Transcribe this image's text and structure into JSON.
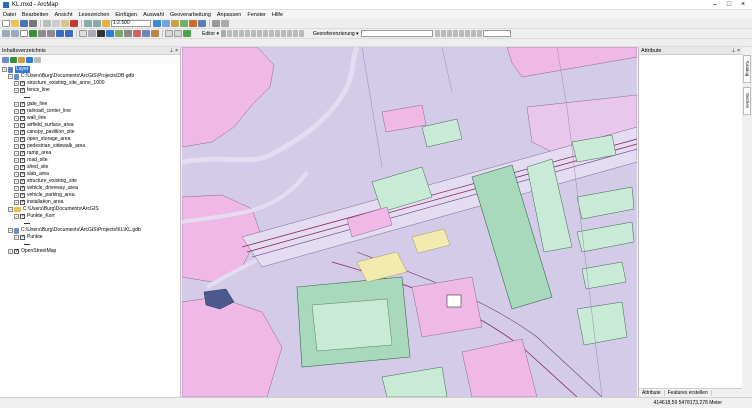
{
  "window": {
    "title": "KL.mxd - ArcMap"
  },
  "menu": [
    "Datei",
    "Bearbeiten",
    "Ansicht",
    "Lesezeichen",
    "Einfügen",
    "Auswahl",
    "Geoverarbeitung",
    "Anpassen",
    "Fenster",
    "Hilfe"
  ],
  "toolbar": {
    "scale": "1:2.500",
    "editor_label": "Editor ▾",
    "georef_label": "Georeferenzierung ▾"
  },
  "toc": {
    "title": "Inhaltsverzeichnis",
    "root_label": "Layer",
    "gdb1_path": "C:\\Users\\Burg\\Documents\\ArcGIS\\Projects\\DB.gdb",
    "gdb1_layers": [
      "structure_existing_site_anno_1000",
      "fence_line",
      "gate_line",
      "railroad_center_line",
      "wall_line",
      "airfield_surface_area",
      "canopy_pavillion_site",
      "open_storage_area",
      "pedestrian_sidewalk_area",
      "ramp_area",
      "road_site",
      "shed_site",
      "slab_area",
      "structure_existing_site",
      "vehicle_driveway_area",
      "vehicle_parking_area",
      "installation_area"
    ],
    "folder_path": "C:\\Users\\Burg\\Documents\\ArcGIS",
    "folder_layer": "Punkte_Korr",
    "gdb2_path": "C:\\Users\\Burg\\Documents\\ArcGIS\\Projects\\KL\\KL.gdb",
    "gdb2_layer": "Punkte",
    "basemap": "OpenStreetMap"
  },
  "attributes": {
    "title": "Attribute",
    "footer_tabs": [
      "Attribute",
      "Features erstellen"
    ]
  },
  "side_tabs": [
    "Katalog",
    "Suchen"
  ],
  "status": {
    "coordinates": "414618,59  5478173,278 Meter"
  },
  "colors": {
    "map_background": "#d4cbe8",
    "area_pink": "#f0b8e6",
    "area_green": "#c9ead6",
    "area_green_dark": "#a9d9bc",
    "road_light": "#e4dcf2",
    "area_yellow": "#f3eab0",
    "water": "#4b5a8c",
    "selection": "#3579d5"
  }
}
